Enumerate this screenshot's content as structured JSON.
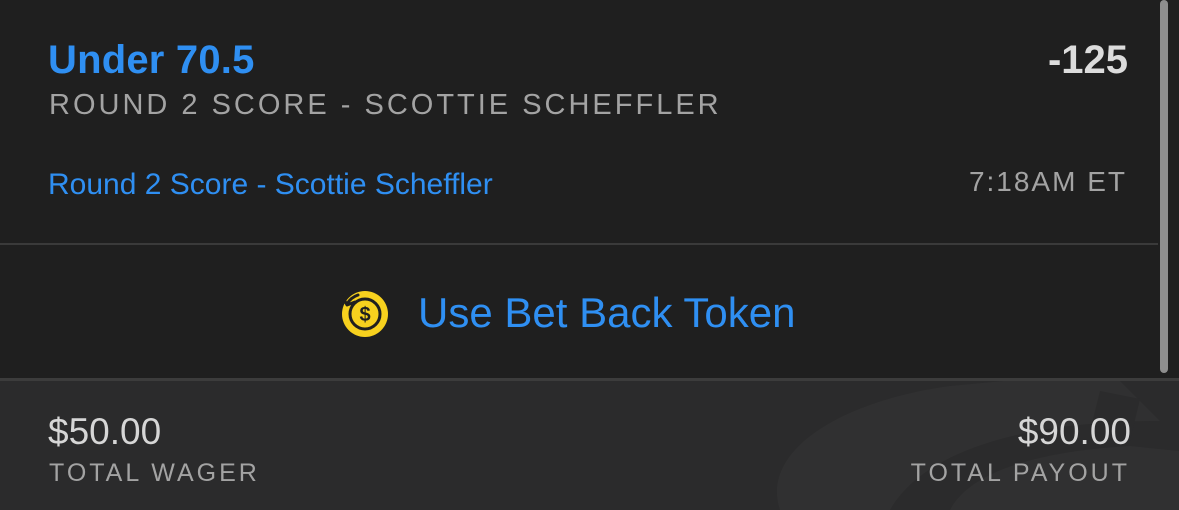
{
  "bet": {
    "selection": "Under 70.5",
    "odds": "-125",
    "market": "ROUND 2 SCORE - SCOTTIE SCHEFFLER",
    "event_link": "Round 2 Score - Scottie Scheffler",
    "time": "7:18AM ET"
  },
  "bet_back": {
    "label": "Use Bet Back Token",
    "icon": "bet-back-token-icon",
    "icon_color": "#f7d11e"
  },
  "summary": {
    "total_wager_amount": "$50.00",
    "total_wager_label": "TOTAL WAGER",
    "total_payout_amount": "$90.00",
    "total_payout_label": "TOTAL PAYOUT"
  },
  "colors": {
    "accent": "#2f8ff2",
    "background": "#1f1f1f",
    "footer_background": "#2b2b2c"
  }
}
